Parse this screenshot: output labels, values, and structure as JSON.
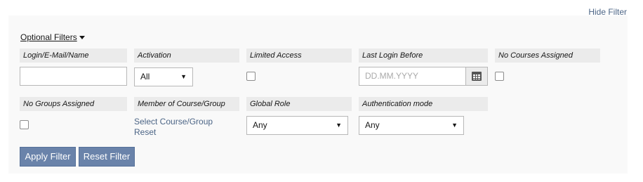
{
  "header": {
    "hide_filter": "Hide Filter"
  },
  "optional_filters": {
    "label": "Optional Filters"
  },
  "fields": {
    "login": {
      "label": "Login/E-Mail/Name",
      "value": ""
    },
    "activation": {
      "label": "Activation",
      "selected": "All"
    },
    "limited_access": {
      "label": "Limited Access",
      "checked": false
    },
    "last_login": {
      "label": "Last Login Before",
      "placeholder": "DD.MM.YYYY"
    },
    "no_courses": {
      "label": "No Courses Assigned",
      "checked": false
    },
    "no_groups": {
      "label": "No Groups Assigned",
      "checked": false
    },
    "member_of": {
      "label": "Member of Course/Group",
      "select_link": "Select Course/Group",
      "reset_link": "Reset"
    },
    "global_role": {
      "label": "Global Role",
      "selected": "Any"
    },
    "auth_mode": {
      "label": "Authentication mode",
      "selected": "Any"
    }
  },
  "buttons": {
    "apply": "Apply Filter",
    "reset": "Reset Filter"
  },
  "icons": {
    "calendar": "calendar-icon",
    "caret": "caret-down-icon",
    "select_arrow": "triangle-down-icon"
  },
  "colors": {
    "link": "#4c6586",
    "button": "#6a83aa",
    "panel_bg": "#f9f9f9",
    "label_bg": "#ebebeb"
  }
}
